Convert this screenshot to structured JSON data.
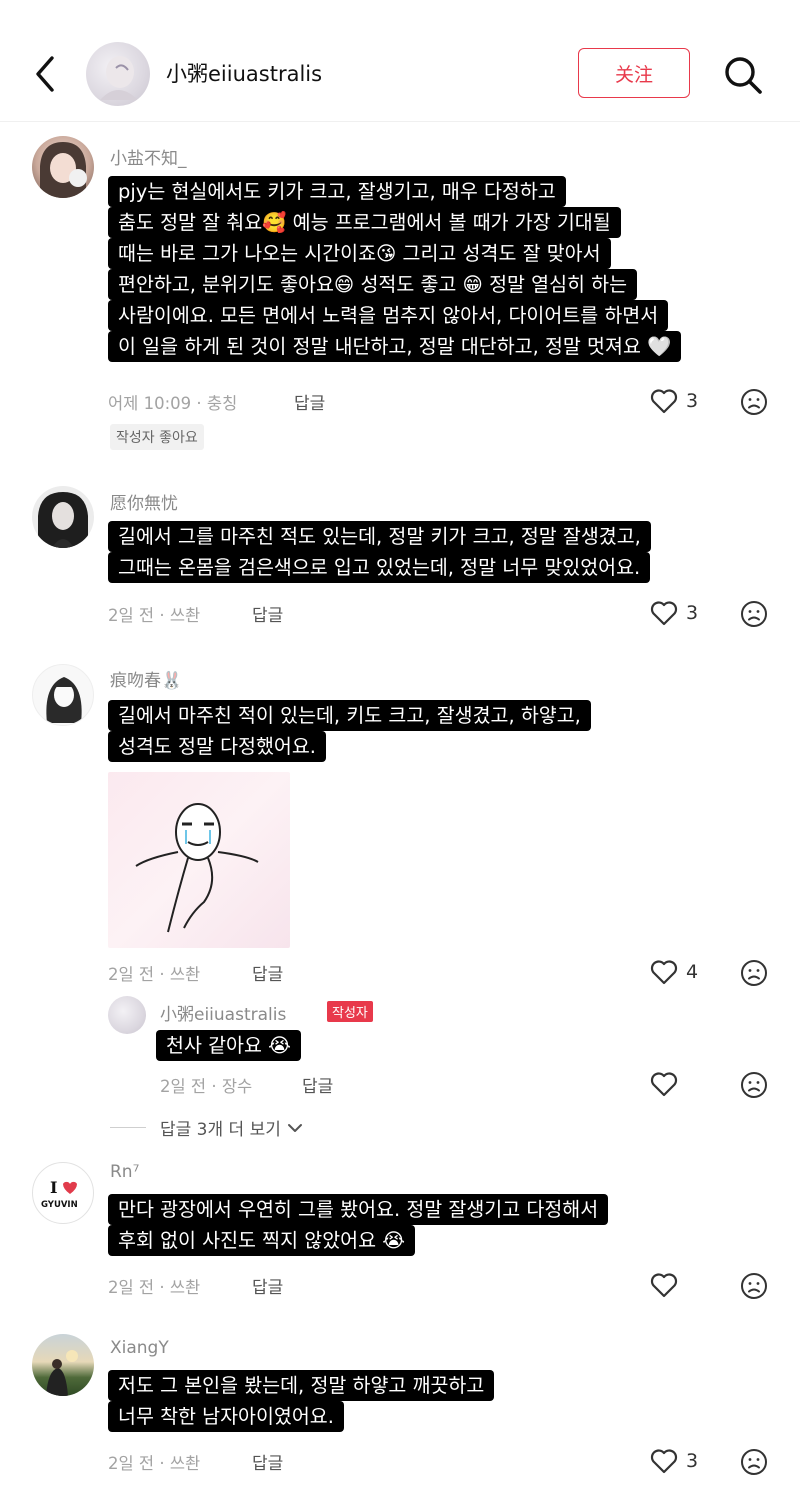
{
  "header": {
    "title": "小粥eiiuastralis",
    "follow_label": "关注"
  },
  "comments": [
    {
      "username": "小盐不知_",
      "lines": [
        "pjy는 현실에서도 키가 크고, 잘생기고, 매우 다정하고",
        "춤도 정말 잘 춰요🥰 예능 프로그램에서 볼 때가 가장 기대될",
        "때는 바로 그가 나오는 시간이죠😘 그리고 성격도 잘 맞아서",
        "편안하고, 분위기도 좋아요😄 성적도 좋고 😁 정말 열심히 하는",
        "사람이에요. 모든 면에서 노력을 멈추지 않아서, 다이어트를 하면서",
        "이 일을 하게 된 것이 정말 내단하고, 정말 대단하고, 정말 멋져요 🤍"
      ],
      "time": "어제 10:09 · 충칭",
      "reply_label": "답글",
      "likes": "3",
      "author_liked": "작성자 좋아요"
    },
    {
      "username": "愿你無忧",
      "lines": [
        "길에서 그를 마주친 적도 있는데, 정말 키가 크고, 정말 잘생겼고,",
        "그때는 온몸을 검은색으로 입고 있었는데, 정말 너무 맞있었어요."
      ],
      "time": "2일 전 · 쓰촨",
      "reply_label": "답글",
      "likes": "3"
    },
    {
      "username": "痕吻春🐰",
      "lines": [
        "길에서 마주친 적이 있는데, 키도 크고, 잘생겼고, 하얗고,",
        "성격도 정말 다정했어요."
      ],
      "time": "2일 전 · 쓰촨",
      "reply_label": "답글",
      "likes": "4"
    },
    {
      "username": "Rn⁷",
      "avatar_text": "I ❤ GYUVIN",
      "lines": [
        "만다 광장에서 우연히 그를 봤어요. 정말 잘생기고 다정해서",
        "후회 없이 사진도 찍지 않았어요 😭"
      ],
      "time": "2일 전 · 쓰촨",
      "reply_label": "답글",
      "likes": ""
    },
    {
      "username": "XiangY",
      "lines": [
        "저도 그 본인을 봤는데, 정말 하얗고 깨끗하고",
        "너무 착한 남자아이였어요."
      ],
      "time": "2일 전 · 쓰촨",
      "reply_label": "답글",
      "likes": "3"
    }
  ],
  "reply": {
    "username": "小粥eiiuastralis",
    "badge": "작성자",
    "lines": [
      "천사 같아요 😭"
    ],
    "time": "2일 전 · 장수",
    "reply_label": "답글"
  },
  "more_replies_label": "답글 3개 더 보기",
  "icons": {
    "back": "chevron-left-icon",
    "search": "search-icon",
    "like": "heart-outline-icon",
    "dislike": "frown-face-icon",
    "expand": "chevron-down-icon"
  },
  "colors": {
    "accent": "#e8394b",
    "bubble_bg": "#000000",
    "bubble_text": "#ffffff"
  }
}
